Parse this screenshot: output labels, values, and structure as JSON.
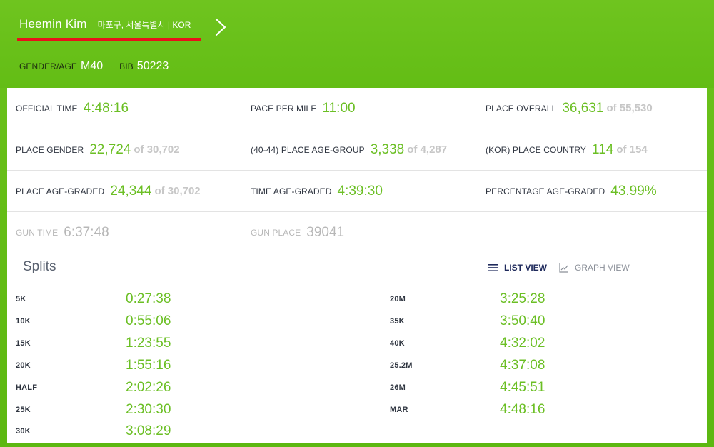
{
  "runner": {
    "name": "Heemin Kim",
    "location": "마포구, 서울특별시 | KOR",
    "gender_age_label": "GENDER/AGE",
    "gender_age": "M40",
    "bib_label": "BIB",
    "bib": "50223"
  },
  "stats": [
    [
      {
        "label": "OFFICIAL TIME",
        "value": "4:48:16",
        "of": ""
      },
      {
        "label": "PACE PER MILE",
        "value": "11:00",
        "of": ""
      },
      {
        "label": "PLACE OVERALL",
        "value": "36,631",
        "of": "of 55,530"
      }
    ],
    [
      {
        "label": "PLACE GENDER",
        "value": "22,724",
        "of": "of 30,702"
      },
      {
        "label": "(40-44) PLACE AGE-GROUP",
        "value": "3,338",
        "of": "of 4,287"
      },
      {
        "label": "(KOR) PLACE COUNTRY",
        "value": "114",
        "of": "of 154"
      }
    ],
    [
      {
        "label": "PLACE AGE-GRADED",
        "value": "24,344",
        "of": "of 30,702"
      },
      {
        "label": "TIME AGE-GRADED",
        "value": "4:39:30",
        "of": ""
      },
      {
        "label": "PERCENTAGE AGE-GRADED",
        "value": "43.99%",
        "of": ""
      }
    ],
    [
      {
        "label": "GUN TIME",
        "value": "6:37:48",
        "of": ""
      },
      {
        "label": "GUN PLACE",
        "value": "39041",
        "of": ""
      }
    ]
  ],
  "splits": {
    "title": "Splits",
    "list_view_label": "LIST VIEW",
    "graph_view_label": "GRAPH VIEW",
    "left": [
      {
        "label": "5K",
        "time": "0:27:38"
      },
      {
        "label": "10K",
        "time": "0:55:06"
      },
      {
        "label": "15K",
        "time": "1:23:55"
      },
      {
        "label": "20K",
        "time": "1:55:16"
      },
      {
        "label": "HALF",
        "time": "2:02:26"
      },
      {
        "label": "25K",
        "time": "2:30:30"
      },
      {
        "label": "30K",
        "time": "3:08:29"
      }
    ],
    "right": [
      {
        "label": "20M",
        "time": "3:25:28"
      },
      {
        "label": "35K",
        "time": "3:50:40"
      },
      {
        "label": "40K",
        "time": "4:32:02"
      },
      {
        "label": "25.2M",
        "time": "4:37:08"
      },
      {
        "label": "26M",
        "time": "4:45:51"
      },
      {
        "label": "MAR",
        "time": "4:48:16"
      }
    ]
  },
  "colors": {
    "accent_green": "#6bbf24",
    "header_green": "#63bd15",
    "underline_red": "#e8101a"
  }
}
